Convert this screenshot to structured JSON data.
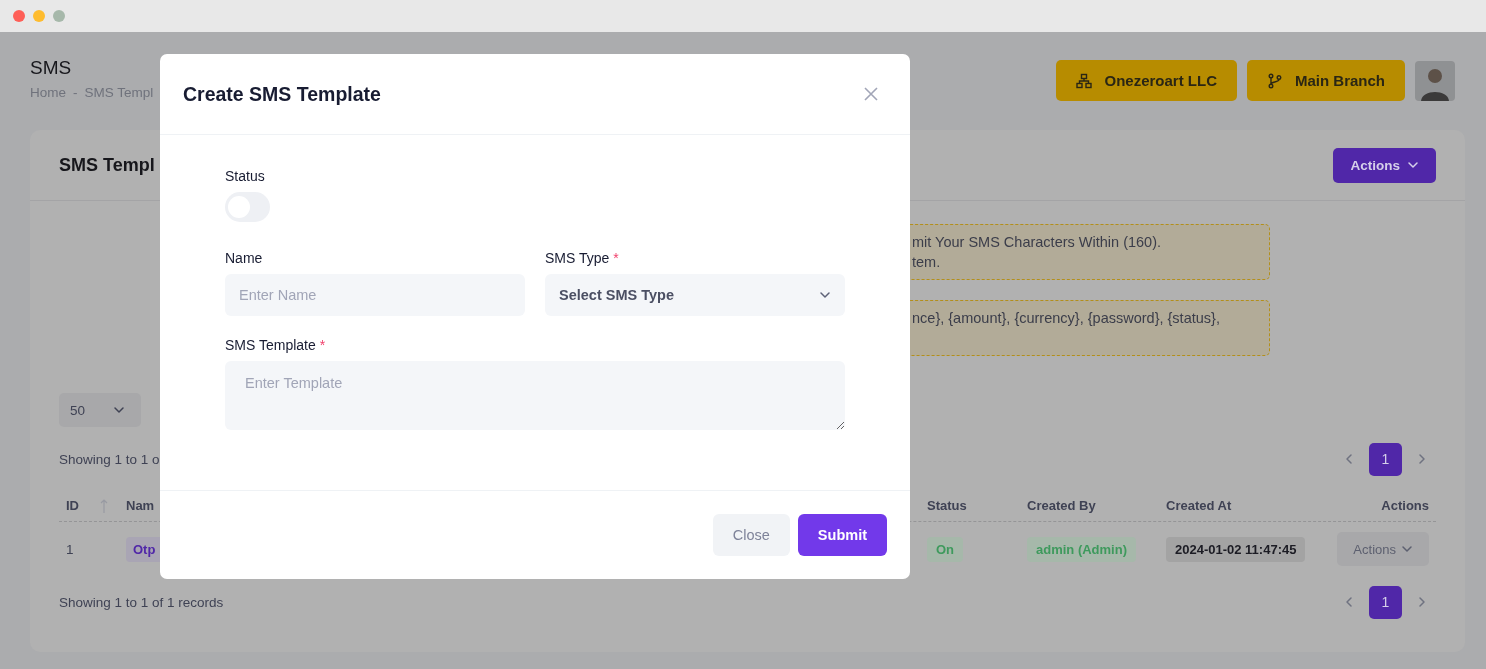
{
  "page": {
    "title": "SMS",
    "breadcrumb": {
      "separator": "-",
      "items": [
        {
          "label": "Home"
        },
        {
          "label": "SMS Templ"
        }
      ]
    }
  },
  "header_buttons": [
    {
      "label": "Onezeroart LLC",
      "kind": "network"
    },
    {
      "label": "Main Branch",
      "kind": "branch"
    }
  ],
  "card": {
    "title": "SMS Templ",
    "actions_button": "Actions",
    "notices": [
      {
        "lines": [
          "mit Your SMS Characters Within (160).",
          "tem."
        ]
      },
      {
        "lines": [
          "nce}, {amount}, {currency}, {password}, {status},"
        ]
      }
    ],
    "page_size": "50",
    "showing_top": "Showing 1 to 1 o",
    "pagination_top": [
      {
        "label": "1",
        "selected": true
      }
    ],
    "table": {
      "columns": [
        {
          "label": "ID",
          "kind": "sortable"
        },
        {
          "label": "Nam",
          "kind": "plain"
        },
        {
          "label": "Status",
          "kind": "plain"
        },
        {
          "label": "Created By",
          "kind": "plain"
        },
        {
          "label": "Created At",
          "kind": "plain"
        },
        {
          "label": "Actions",
          "kind": "plain"
        }
      ],
      "rows": [
        {
          "id": "1",
          "name": "Otp",
          "status": "On",
          "created_by": "admin (Admin)",
          "created_at": "2024-01-02 11:47:45",
          "actions": "Actions"
        }
      ]
    },
    "showing_bottom": "Showing 1 to 1 of 1 records",
    "pagination_bottom": [
      {
        "label": "1",
        "selected": true
      }
    ]
  },
  "modal": {
    "title": "Create SMS Template",
    "required_mark": "*",
    "status": {
      "label": "Status",
      "on": false
    },
    "name": {
      "label": "Name",
      "placeholder": "Enter Name",
      "required": false
    },
    "sms_type": {
      "label": "SMS Type",
      "value": "Select SMS Type",
      "required": true
    },
    "template": {
      "label": "SMS Template",
      "placeholder": "Enter Template",
      "required": true
    },
    "buttons": [
      {
        "label": "Close",
        "kind": "secondary"
      },
      {
        "label": "Submit",
        "kind": "primary"
      }
    ]
  }
}
